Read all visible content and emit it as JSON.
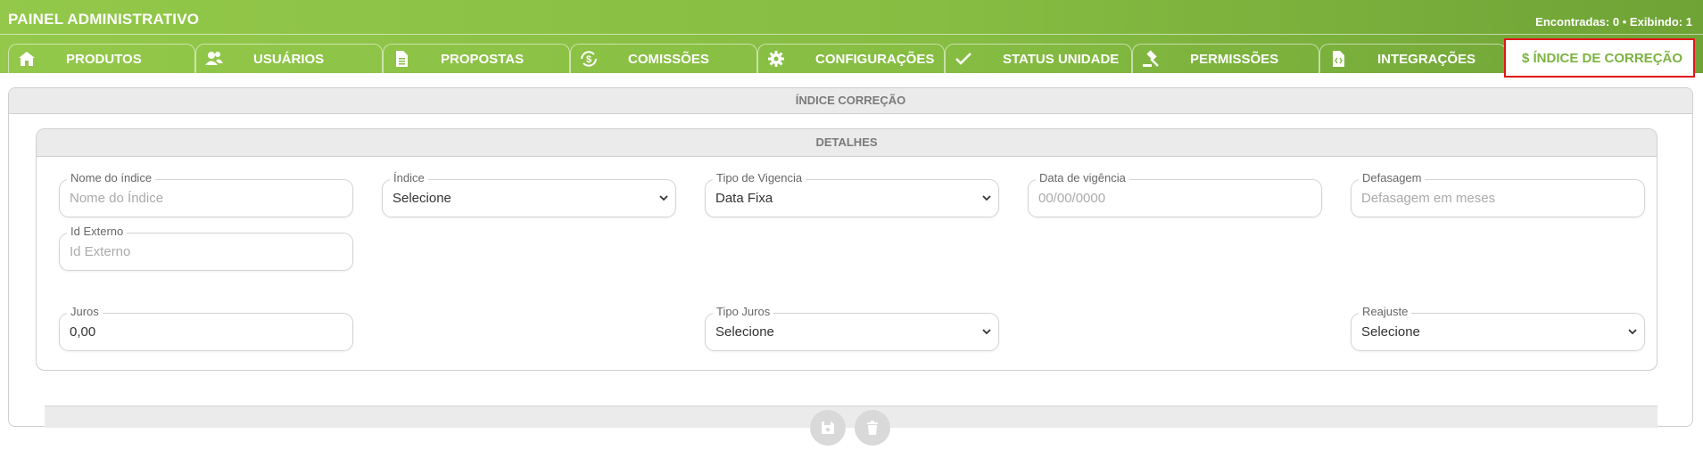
{
  "header": {
    "title": "PAINEL ADMINISTRATIVO",
    "counter_label_found": "Encontradas:",
    "counter_found": "0",
    "counter_sep": "•",
    "counter_label_showing": "Exibindo:",
    "counter_showing": "1"
  },
  "tabs": [
    {
      "label": "PRODUTOS",
      "icon": "home-icon"
    },
    {
      "label": "USUÁRIOS",
      "icon": "users-icon"
    },
    {
      "label": "PROPOSTAS",
      "icon": "document-icon"
    },
    {
      "label": "COMISSÕES",
      "icon": "money-cycle-icon"
    },
    {
      "label": "CONFIGURAÇÕES",
      "icon": "gear-icon"
    },
    {
      "label": "STATUS UNIDADE",
      "icon": "check-icon"
    },
    {
      "label": "PERMISSÕES",
      "icon": "gavel-icon"
    },
    {
      "label": "INTEGRAÇÕES",
      "icon": "code-file-icon"
    },
    {
      "label": "$ ÍNDICE DE CORREÇÃO",
      "icon": "dollar-icon",
      "active": true
    }
  ],
  "panel": {
    "title": "ÍNDICE CORREÇÃO"
  },
  "details": {
    "title": "DETALHES",
    "fields": {
      "nome": {
        "label": "Nome do índice",
        "placeholder": "Nome do Índice"
      },
      "indice": {
        "label": "Índice",
        "value": "Selecione"
      },
      "tipo_vigencia": {
        "label": "Tipo de Vigencia",
        "value": "Data Fixa"
      },
      "data_vigencia": {
        "label": "Data de vigência",
        "placeholder": "00/00/0000"
      },
      "defasagem": {
        "label": "Defasagem",
        "placeholder": "Defasagem em meses"
      },
      "id_externo": {
        "label": "Id Externo",
        "placeholder": "Id Externo"
      },
      "juros": {
        "label": "Juros",
        "value": "0,00"
      },
      "tipo_juros": {
        "label": "Tipo Juros",
        "value": "Selecione"
      },
      "reajuste": {
        "label": "Reajuste",
        "value": "Selecione"
      }
    }
  },
  "actions": [
    {
      "name": "save-button",
      "icon": "floppy-icon"
    },
    {
      "name": "delete-button",
      "icon": "trash-icon"
    }
  ],
  "colors": {
    "brand_green": "#86bd42",
    "active_tab_text": "#7cb342",
    "highlight_border": "#e0161b"
  }
}
